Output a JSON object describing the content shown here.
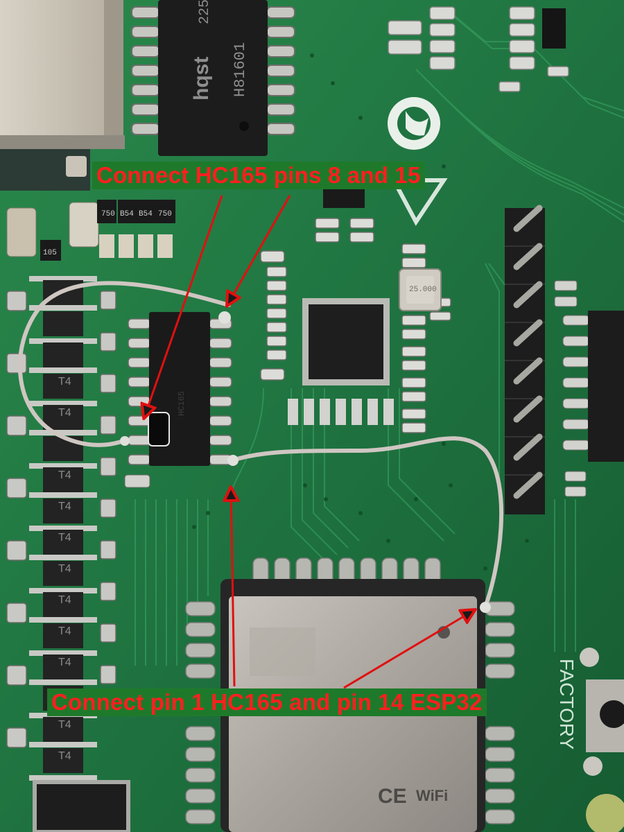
{
  "annotations": {
    "top_label": "Connect HC165 pins 8 and 15",
    "bottom_label": "Connect pin 1 HC165 and pin 14 ESP32"
  },
  "board_markings": {
    "transformer_brand": "hqst",
    "transformer_part": "H81601",
    "transformer_code": "225",
    "crystal": "25.000",
    "factory_button": "FACTORY",
    "wifi_mark": "WiFi",
    "diode_marks": [
      "T4",
      "T4",
      "T4",
      "T4",
      "T4",
      "T4",
      "T4",
      "T4",
      "T4",
      "T4",
      "T4"
    ],
    "smd_codes": [
      "750",
      "B54",
      "B54",
      "750",
      "105"
    ]
  },
  "colors": {
    "pcb": "#1f6e3c",
    "label_bg": "#1e7a2a",
    "label_text": "#ff1f1f",
    "arrow": "#e01010",
    "wire": "#cfc6c2"
  }
}
